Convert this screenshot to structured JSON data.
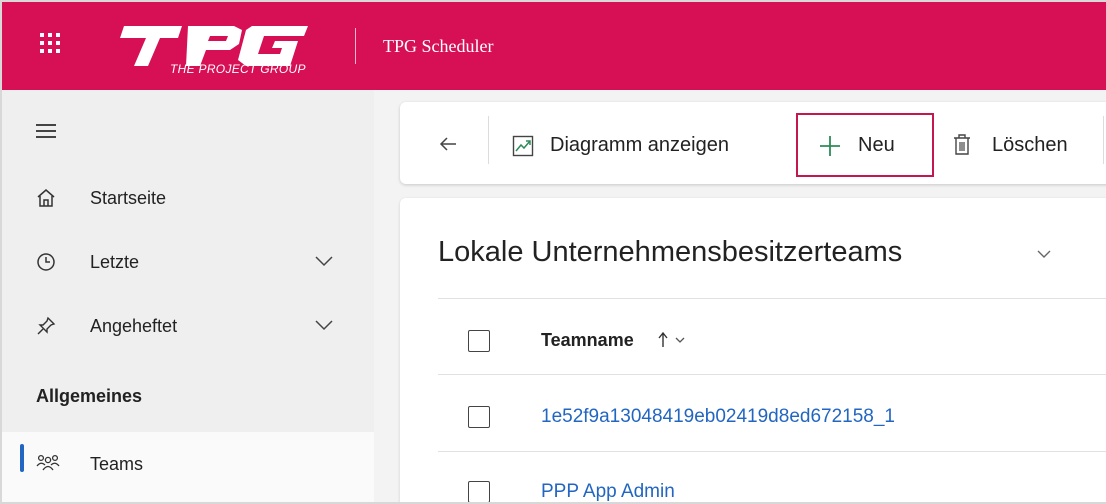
{
  "header": {
    "brand": "TPG",
    "brand_subtitle": "THE PROJECT GROUP",
    "app_title": "TPG Scheduler"
  },
  "sidebar": {
    "items": [
      {
        "label": "Startseite",
        "icon": "home-icon",
        "expandable": false
      },
      {
        "label": "Letzte",
        "icon": "clock-icon",
        "expandable": true
      },
      {
        "label": "Angeheftet",
        "icon": "pin-icon",
        "expandable": true
      }
    ],
    "section_label": "Allgemeines",
    "section_items": [
      {
        "label": "Teams",
        "icon": "people-icon",
        "selected": true
      }
    ]
  },
  "commandbar": {
    "back_icon": "back-arrow-icon",
    "show_chart_label": "Diagramm anzeigen",
    "new_label": "Neu",
    "delete_label": "Löschen"
  },
  "view": {
    "title": "Lokale Unternehmensbesitzerteams",
    "columns": [
      {
        "label": "Teamname",
        "sort": "ascending"
      }
    ],
    "rows": [
      {
        "teamname": "1e52f9a13048419eb02419d8ed672158_1"
      },
      {
        "teamname": "PPP App Admin"
      }
    ]
  },
  "colors": {
    "brand": "#d70f55",
    "accent": "#2266c2",
    "highlight_box": "#c5174f",
    "new_plus": "#2e8b57"
  }
}
